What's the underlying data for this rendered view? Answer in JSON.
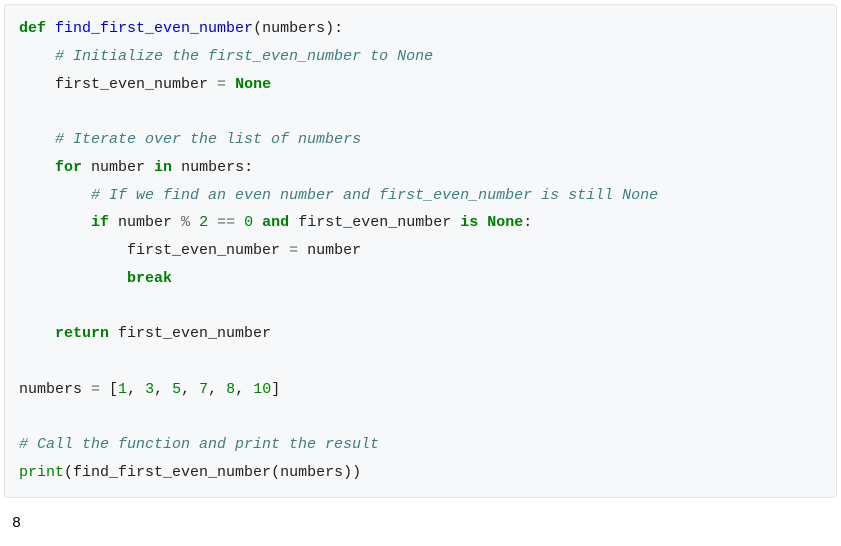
{
  "code": {
    "l1": {
      "kw_def": "def",
      "fn": "find_first_even_number",
      "p_open": "(",
      "arg": "numbers",
      "p_close": "):"
    },
    "l2": {
      "indent": "    ",
      "cm": "# Initialize the first_even_number to None"
    },
    "l3": {
      "indent": "    ",
      "var": "first_even_number ",
      "op": "=",
      "sp": " ",
      "none": "None"
    },
    "l4": {
      "blank": " "
    },
    "l5": {
      "indent": "    ",
      "cm": "# Iterate over the list of numbers"
    },
    "l6": {
      "indent": "    ",
      "for": "for",
      "sp1": " number ",
      "in": "in",
      "sp2": " numbers:"
    },
    "l7": {
      "indent": "        ",
      "cm": "# If we find an even number and first_even_number is still None"
    },
    "l8": {
      "indent": "        ",
      "if": "if",
      "sp1": " number ",
      "op1": "%",
      "sp2": " ",
      "n2": "2",
      "sp3": " ",
      "op2": "==",
      "sp4": " ",
      "n0": "0",
      "sp5": " ",
      "and": "and",
      "sp6": " first_even_number ",
      "is": "is",
      "sp7": " ",
      "none": "None",
      "colon": ":"
    },
    "l9": {
      "indent": "            ",
      "var": "first_even_number ",
      "op": "=",
      "rest": " number"
    },
    "l10": {
      "indent": "            ",
      "break": "break"
    },
    "l11": {
      "blank": " "
    },
    "l12": {
      "indent": "    ",
      "return": "return",
      "rest": " first_even_number"
    },
    "l13": {
      "blank": " "
    },
    "l14": {
      "var": "numbers ",
      "op": "=",
      "sp": " [",
      "n1": "1",
      "c1": ", ",
      "n2": "3",
      "c2": ", ",
      "n3": "5",
      "c3": ", ",
      "n4": "7",
      "c4": ", ",
      "n5": "8",
      "c5": ", ",
      "n6": "10",
      "close": "]"
    },
    "l15": {
      "blank": " "
    },
    "l16": {
      "cm": "# Call the function and print the result"
    },
    "l17": {
      "print": "print",
      "open": "(",
      "fn": "find_first_even_number",
      "args": "(numbers))"
    }
  },
  "output": "8"
}
